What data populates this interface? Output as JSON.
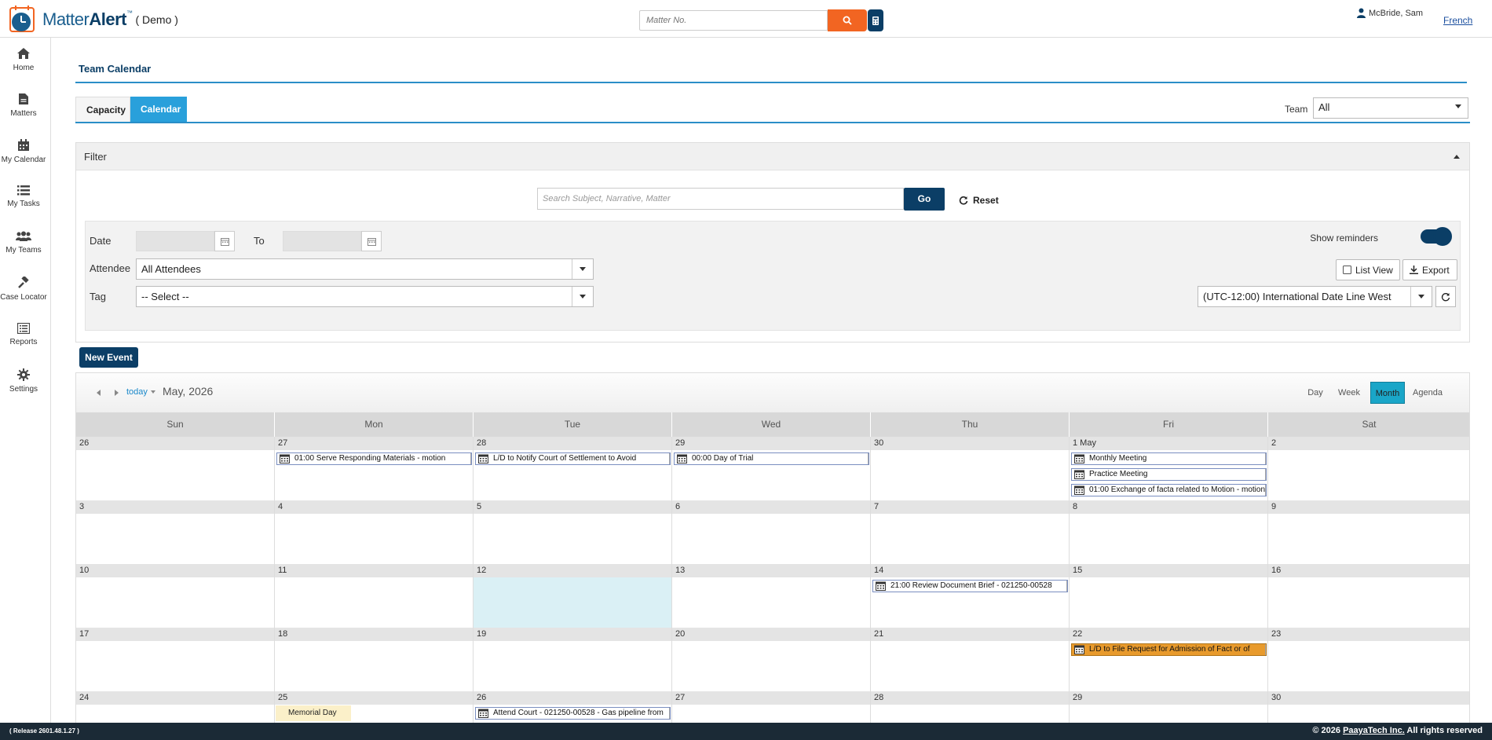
{
  "header": {
    "logo_matter": "Matter",
    "logo_alert": "Alert",
    "logo_tm": "™",
    "logo_demo": "( Demo )",
    "matter_placeholder": "Matter No.",
    "user_name": "McBride, Sam",
    "language_link": "French",
    "accent_color": "#f26522",
    "brand_color": "#0b3e66"
  },
  "sidebar": {
    "items": [
      {
        "label": "Home",
        "icon": "home-icon"
      },
      {
        "label": "Matters",
        "icon": "file-icon"
      },
      {
        "label": "My Calendar",
        "icon": "calendar-icon"
      },
      {
        "label": "My Tasks",
        "icon": "list-icon"
      },
      {
        "label": "My Teams",
        "icon": "users-icon"
      },
      {
        "label": "Case Locator",
        "icon": "gavel-icon"
      },
      {
        "label": "Reports",
        "icon": "report-icon"
      },
      {
        "label": "Settings",
        "icon": "gear-icon"
      }
    ]
  },
  "page": {
    "title": "Team Calendar",
    "tabs": [
      {
        "label": "Capacity",
        "active": false
      },
      {
        "label": "Calendar",
        "active": true
      }
    ],
    "team_label": "Team",
    "team_value": "All"
  },
  "filter": {
    "header": "Filter",
    "search_placeholder": "Search Subject, Narrative, Matter",
    "go_label": "Go",
    "reset_label": "Reset",
    "date_label": "Date",
    "to_label": "To",
    "attendee_label": "Attendee",
    "attendee_value": "All Attendees",
    "tag_label": "Tag",
    "tag_value": "-- Select --",
    "show_reminders_label": "Show reminders",
    "show_reminders_on": true,
    "list_view_label": "List View",
    "export_label": "Export",
    "timezone_value": "(UTC-12:00) International Date Line West"
  },
  "new_event_label": "New Event",
  "calendar": {
    "today_label": "today",
    "month_title": "May, 2026",
    "views": [
      {
        "label": "Day",
        "active": false
      },
      {
        "label": "Week",
        "active": false
      },
      {
        "label": "Month",
        "active": true
      },
      {
        "label": "Agenda",
        "active": false
      }
    ],
    "day_names": [
      "Sun",
      "Mon",
      "Tue",
      "Wed",
      "Thu",
      "Fri",
      "Sat"
    ],
    "weeks": [
      {
        "days": [
          "26",
          "27",
          "28",
          "29",
          "30",
          "1 May",
          "2"
        ]
      },
      {
        "days": [
          "3",
          "4",
          "5",
          "6",
          "7",
          "8",
          "9"
        ]
      },
      {
        "days": [
          "10",
          "11",
          "12",
          "13",
          "14",
          "15",
          "16"
        ]
      },
      {
        "days": [
          "17",
          "18",
          "19",
          "20",
          "21",
          "22",
          "23"
        ]
      },
      {
        "days": [
          "24",
          "25",
          "26",
          "27",
          "28",
          "29",
          "30"
        ]
      }
    ],
    "today_position": {
      "week": 2,
      "day": 2
    },
    "events": [
      {
        "week": 0,
        "day": 1,
        "slot": 0,
        "text": "01:00 Serve Responding Materials - motion",
        "style": "normal"
      },
      {
        "week": 0,
        "day": 2,
        "slot": 0,
        "text": "L/D to Notify Court of Settlement to Avoid",
        "style": "normal"
      },
      {
        "week": 0,
        "day": 3,
        "slot": 0,
        "text": "00:00 Day of Trial",
        "style": "normal"
      },
      {
        "week": 0,
        "day": 5,
        "slot": 0,
        "text": "Monthly Meeting",
        "style": "normal"
      },
      {
        "week": 0,
        "day": 5,
        "slot": 1,
        "text": "Practice Meeting",
        "style": "normal"
      },
      {
        "week": 0,
        "day": 5,
        "slot": 2,
        "text": "01:00 Exchange of facta related to Motion - motion",
        "style": "normal"
      },
      {
        "week": 2,
        "day": 4,
        "slot": 0,
        "text": "21:00 Review Document Brief - 021250-00528",
        "style": "normal"
      },
      {
        "week": 3,
        "day": 5,
        "slot": 0,
        "text": "L/D to File Request for Admission of Fact or of",
        "style": "orange"
      },
      {
        "week": 4,
        "day": 2,
        "slot": 0,
        "text": "Attend Court - 021250-00528 - Gas pipeline from",
        "style": "normal"
      }
    ],
    "holidays": [
      {
        "week": 4,
        "day": 1,
        "text": "Memorial Day"
      }
    ]
  },
  "footer": {
    "release": "( Release 2601.48.1.27 )",
    "copyright_prefix": "© 2026",
    "company": "PaayaTech Inc.",
    "copyright_suffix": "All rights reserved"
  }
}
